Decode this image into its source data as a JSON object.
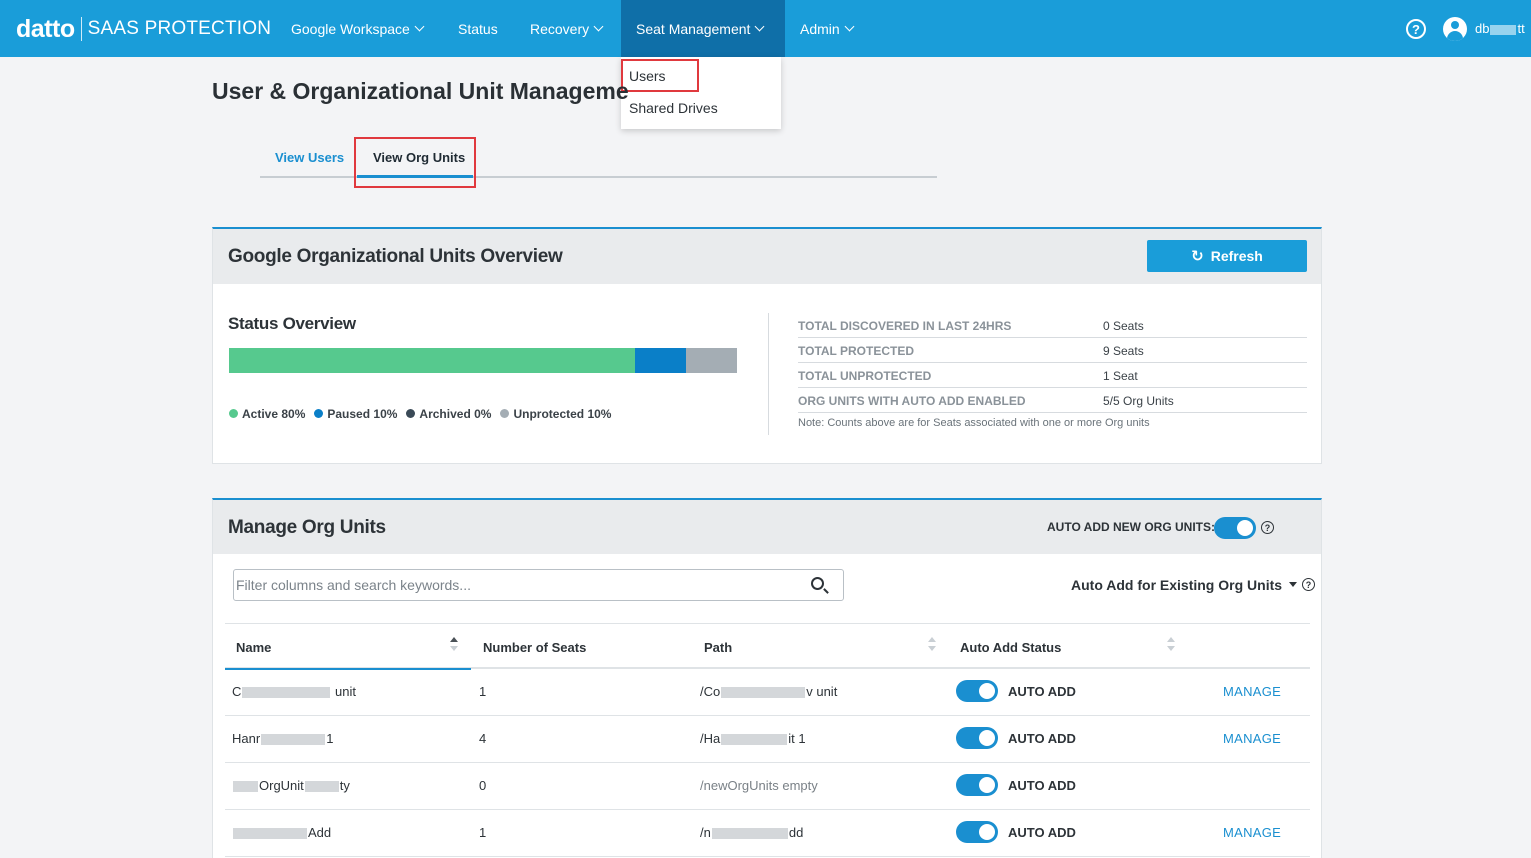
{
  "app": {
    "logo_word": "datto",
    "logo_sub": "SAAS PROTECTION"
  },
  "nav": {
    "items": [
      {
        "label": "Google Workspace",
        "dropdown": true
      },
      {
        "label": "Status",
        "dropdown": false
      },
      {
        "label": "Recovery",
        "dropdown": true
      },
      {
        "label": "Seat Management",
        "dropdown": true,
        "active": true
      },
      {
        "label": "Admin",
        "dropdown": true
      }
    ],
    "help": "?",
    "user_prefix": "db",
    "user_suffix": "tt"
  },
  "dropdown": {
    "items": [
      "Users",
      "Shared Drives"
    ]
  },
  "page": {
    "title": "User & Organizational Unit Manageme"
  },
  "tabs": {
    "view_users": "View Users",
    "view_org_units": "View Org Units"
  },
  "overview": {
    "title": "Google Organizational Units Overview",
    "refresh_label": "Refresh",
    "status_title": "Status Overview",
    "status_bar": [
      {
        "name": "Active",
        "percent": 80,
        "color": "#56c98e"
      },
      {
        "name": "Paused",
        "percent": 10,
        "color": "#0a7fc8"
      },
      {
        "name": "Archived",
        "percent": 0,
        "color": "#3a4a57"
      },
      {
        "name": "Unprotected",
        "percent": 10,
        "color": "#a4adb4"
      }
    ],
    "legend": {
      "active": "Active 80%",
      "paused": "Paused 10%",
      "archived": "Archived 0%",
      "unprotected": "Unprotected 10%"
    },
    "stats": [
      {
        "label": "TOTAL DISCOVERED IN LAST 24HRS",
        "value": "0 Seats"
      },
      {
        "label": "TOTAL PROTECTED",
        "value": "9 Seats"
      },
      {
        "label": "TOTAL UNPROTECTED",
        "value": "1 Seat"
      },
      {
        "label": "ORG UNITS WITH AUTO ADD ENABLED",
        "value": "5/5 Org Units"
      }
    ],
    "note": "Note: Counts above are for Seats associated with one or more Org units"
  },
  "manage": {
    "title": "Manage Org Units",
    "auto_add_label": "AUTO ADD NEW ORG UNITS:",
    "auto_add_enabled": true,
    "search_placeholder": "Filter columns and search keywords...",
    "existing_label": "Auto Add for Existing Org Units",
    "columns": {
      "name": "Name",
      "seats": "Number of Seats",
      "path": "Path",
      "auto_add_status": "Auto Add Status"
    },
    "rows": [
      {
        "name_start": "C",
        "name_end": "unit",
        "seats": "1",
        "path_start": "/Co",
        "path_end": "v unit",
        "status": "AUTO ADD",
        "manage": "MANAGE"
      },
      {
        "name_start": "Hanr",
        "name_end": "1",
        "seats": "4",
        "path_start": "/Ha",
        "path_end": "it 1",
        "status": "AUTO ADD",
        "manage": "MANAGE"
      },
      {
        "name_start": "",
        "name_end": "OrgUnit",
        "name_tail": "ty",
        "seats": "0",
        "path_start": "/newOrgUnits empty",
        "path_end": "",
        "status": "AUTO ADD",
        "manage": ""
      },
      {
        "name_start": "",
        "name_end": "Add",
        "seats": "1",
        "path_start": "/n",
        "path_end": "dd",
        "status": "AUTO ADD",
        "manage": "MANAGE"
      }
    ]
  }
}
